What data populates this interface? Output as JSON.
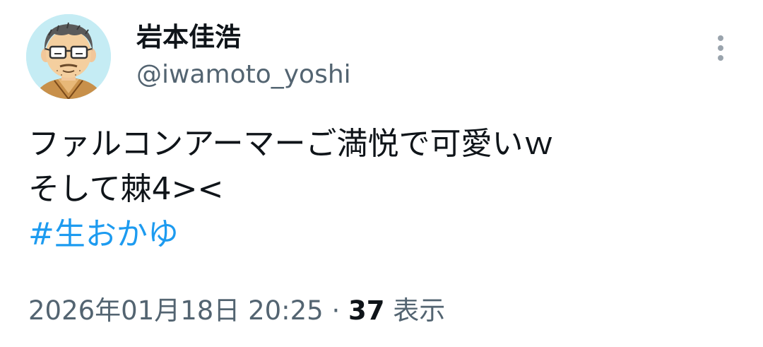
{
  "user": {
    "display_name": "岩本佳浩",
    "handle": "@iwamoto_yoshi"
  },
  "tweet": {
    "lines": [
      "ファルコンアーマーご満悦で可愛いｗ",
      "そして棘4><"
    ],
    "hashtag": "#生おかゆ"
  },
  "meta": {
    "date": "2026年01月18日 20:25",
    "separator": " · ",
    "views_count": "37",
    "views_label": " 表示"
  },
  "icons": {
    "more": "more-vertical-icon",
    "avatar": "avatar-cartoon-man-glasses"
  },
  "colors": {
    "text": "#0f1419",
    "secondary": "#536471",
    "link": "#1d9bf0",
    "avatar_bg": "#c5ecf4"
  }
}
